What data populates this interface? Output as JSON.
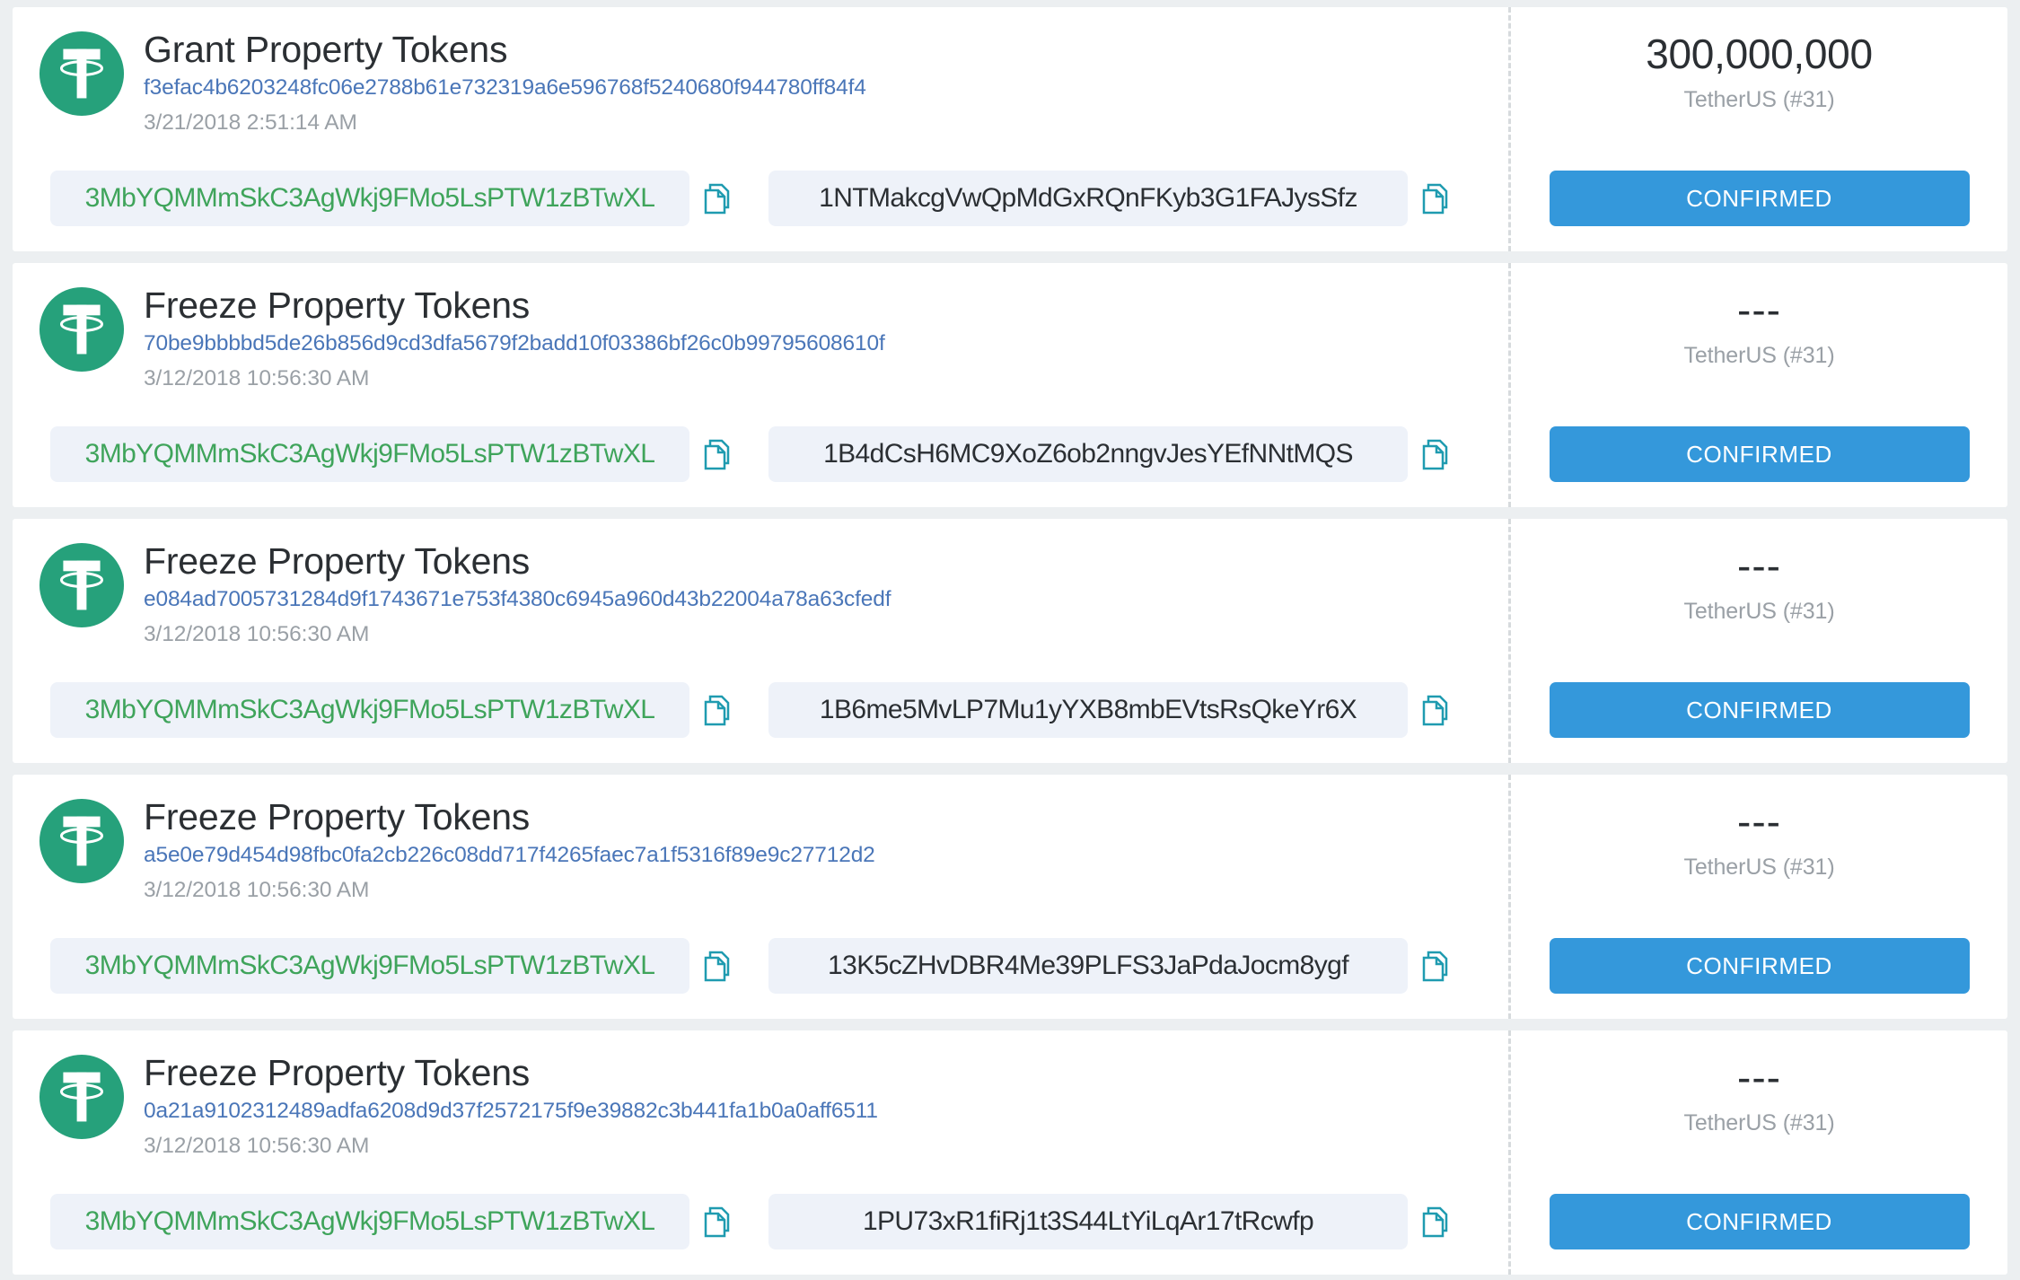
{
  "theme": {
    "page_background": "#eceff1",
    "card_background": "#ffffff",
    "tether_green": "#26a17b",
    "address_green": "#3fa45b",
    "hash_blue": "#4a76b8",
    "status_blue": "#3498db",
    "copy_icon_teal": "#1f9bb0",
    "muted_gray": "#9aa0a6",
    "divider_gray": "#d6dadd",
    "pill_background": "#eef2f9"
  },
  "icons": {
    "tether_logo": "tether-logo-icon",
    "copy": "copy-icon"
  },
  "transactions": [
    {
      "type": "Grant Property Tokens",
      "hash": "f3efac4b6203248fc06e2788b61e732319a6e596768f5240680f944780ff84f4",
      "date": "3/21/2018 2:51:14 AM",
      "sender": "3MbYQMMmSkC3AgWkj9FMo5LsPTW1zBTwXL",
      "receiver": "1NTMakcgVwQpMdGxRQnFKyb3G1FAJysSfz",
      "amount": "300,000,000",
      "token": "TetherUS (#31)",
      "status": "CONFIRMED"
    },
    {
      "type": "Freeze Property Tokens",
      "hash": "70be9bbbbd5de26b856d9cd3dfa5679f2badd10f03386bf26c0b99795608610f",
      "date": "3/12/2018 10:56:30 AM",
      "sender": "3MbYQMMmSkC3AgWkj9FMo5LsPTW1zBTwXL",
      "receiver": "1B4dCsH6MC9XoZ6ob2nngvJesYEfNNtMQS",
      "amount": "---",
      "token": "TetherUS (#31)",
      "status": "CONFIRMED"
    },
    {
      "type": "Freeze Property Tokens",
      "hash": "e084ad7005731284d9f1743671e753f4380c6945a960d43b22004a78a63cfedf",
      "date": "3/12/2018 10:56:30 AM",
      "sender": "3MbYQMMmSkC3AgWkj9FMo5LsPTW1zBTwXL",
      "receiver": "1B6me5MvLP7Mu1yYXB8mbEVtsRsQkeYr6X",
      "amount": "---",
      "token": "TetherUS (#31)",
      "status": "CONFIRMED"
    },
    {
      "type": "Freeze Property Tokens",
      "hash": "a5e0e79d454d98fbc0fa2cb226c08dd717f4265faec7a1f5316f89e9c27712d2",
      "date": "3/12/2018 10:56:30 AM",
      "sender": "3MbYQMMmSkC3AgWkj9FMo5LsPTW1zBTwXL",
      "receiver": "13K5cZHvDBR4Me39PLFS3JaPdaJocm8ygf",
      "amount": "---",
      "token": "TetherUS (#31)",
      "status": "CONFIRMED"
    },
    {
      "type": "Freeze Property Tokens",
      "hash": "0a21a9102312489adfa6208d9d37f2572175f9e39882c3b441fa1b0a0aff6511",
      "date": "3/12/2018 10:56:30 AM",
      "sender": "3MbYQMMmSkC3AgWkj9FMo5LsPTW1zBTwXL",
      "receiver": "1PU73xR1fiRj1t3S44LtYiLqAr17tRcwfp",
      "amount": "---",
      "token": "TetherUS (#31)",
      "status": "CONFIRMED"
    }
  ]
}
